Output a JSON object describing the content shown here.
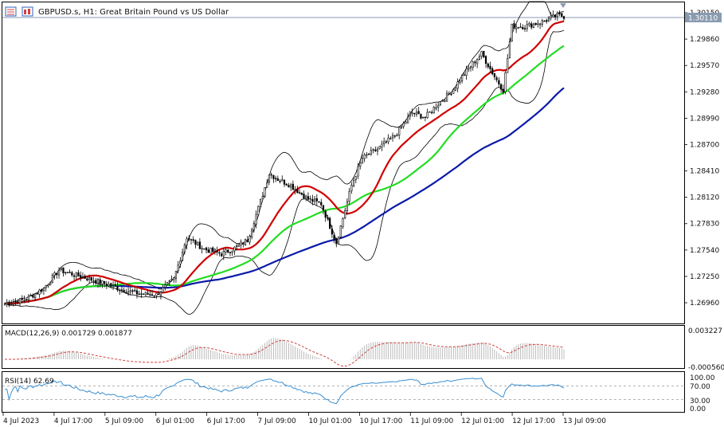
{
  "header": {
    "symbol_text": "GBPUSD.s, H1:  Great Britain Pound vs US Dollar",
    "icons": [
      "menu-icon",
      "chart-type-icon"
    ]
  },
  "price_panel": {
    "current_price_label": "1.30110",
    "price_ticks": [
      "1.30150",
      "1.29860",
      "1.29570",
      "1.29280",
      "1.28990",
      "1.28700",
      "1.28410",
      "1.28120",
      "1.27830",
      "1.27540",
      "1.27250",
      "1.26960"
    ]
  },
  "macd_panel": {
    "title": "MACD(12,26,9) 0.001729 0.001877",
    "ticks": [
      "0.003227",
      "-0.000560"
    ]
  },
  "rsi_panel": {
    "title": "RSI(14) 62.69",
    "ticks": [
      "100.00",
      "70.00",
      "30.00",
      "0.00"
    ]
  },
  "time_axis": [
    "4 Jul 2023",
    "4 Jul 17:00",
    "5 Jul 09:00",
    "6 Jul 01:00",
    "6 Jul 17:00",
    "7 Jul 09:00",
    "10 Jul 01:00",
    "10 Jul 17:00",
    "11 Jul 09:00",
    "12 Jul 01:00",
    "12 Jul 17:00",
    "13 Jul 09:00"
  ],
  "colors": {
    "bull": "#ffffff",
    "bear": "#000000",
    "ma_red": "#d00000",
    "ma_green": "#22dd22",
    "ma_blue": "#0a1aa8",
    "bands": "#000000",
    "macd_hist": "#b4b4b4",
    "macd_signal": "#d04040",
    "rsi": "#3a8ed0",
    "level": "#9a9a9a"
  },
  "chart_data": {
    "type": "line",
    "ylim": [
      1.2675,
      1.3022
    ],
    "x_start": "4 Jul 2023",
    "price_anchors": [
      [
        0,
        1.2695
      ],
      [
        10,
        1.27
      ],
      [
        18,
        1.2712
      ],
      [
        25,
        1.2732
      ],
      [
        35,
        1.2725
      ],
      [
        45,
        1.2718
      ],
      [
        55,
        1.271
      ],
      [
        62,
        1.2706
      ],
      [
        70,
        1.2705
      ],
      [
        78,
        1.2722
      ],
      [
        84,
        1.2768
      ],
      [
        92,
        1.2755
      ],
      [
        100,
        1.275
      ],
      [
        106,
        1.2756
      ],
      [
        112,
        1.2765
      ],
      [
        117,
        1.28
      ],
      [
        122,
        1.2838
      ],
      [
        126,
        1.2832
      ],
      [
        132,
        1.2825
      ],
      [
        140,
        1.281
      ],
      [
        146,
        1.2805
      ],
      [
        150,
        1.278
      ],
      [
        153,
        1.2762
      ],
      [
        160,
        1.2825
      ],
      [
        165,
        1.2855
      ],
      [
        172,
        1.2865
      ],
      [
        180,
        1.288
      ],
      [
        188,
        1.2905
      ],
      [
        194,
        1.29
      ],
      [
        200,
        1.2915
      ],
      [
        206,
        1.2928
      ],
      [
        212,
        1.2948
      ],
      [
        220,
        1.297
      ],
      [
        226,
        1.2945
      ],
      [
        230,
        1.293
      ],
      [
        234,
        1.3
      ],
      [
        240,
        1.3
      ],
      [
        248,
        1.3005
      ],
      [
        255,
        1.3012
      ],
      [
        258,
        1.3011
      ]
    ],
    "n_bars": 259,
    "macd_ylim": [
      -0.00056,
      0.003227
    ],
    "rsi_ylim": [
      0,
      100
    ],
    "rsi_levels": [
      70,
      30
    ]
  }
}
